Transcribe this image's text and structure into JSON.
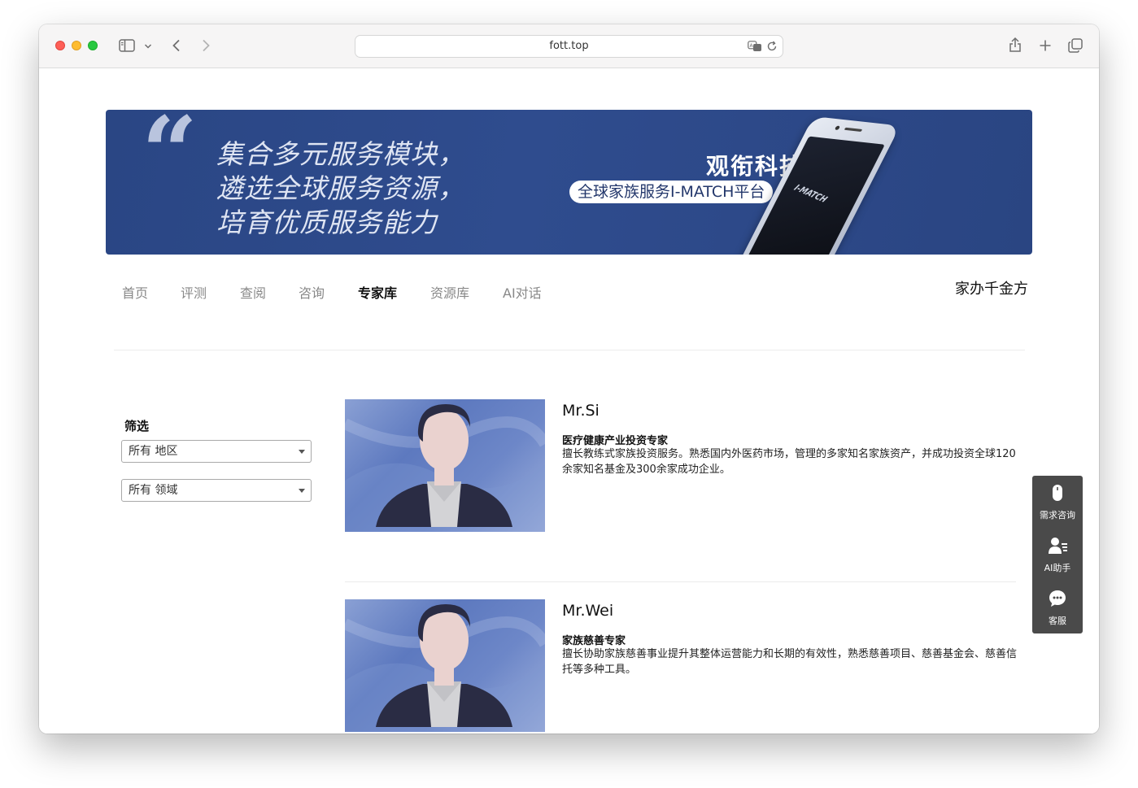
{
  "browser": {
    "url": "fott.top"
  },
  "banner": {
    "slogan_lines": [
      "集合多元服务模块，",
      "遴选全球服务资源，",
      "培育优质服务能力"
    ],
    "brand": "观衔科技",
    "platform": "全球家族服务I-MATCH平台",
    "phone_label": "I-MATCH"
  },
  "nav": {
    "items": [
      {
        "label": "首页",
        "active": false
      },
      {
        "label": "评测",
        "active": false
      },
      {
        "label": "查阅",
        "active": false
      },
      {
        "label": "咨询",
        "active": false
      },
      {
        "label": "专家库",
        "active": true
      },
      {
        "label": "资源库",
        "active": false
      },
      {
        "label": "AI对话",
        "active": false
      }
    ],
    "brand": "家办千金方"
  },
  "filter": {
    "title": "筛选",
    "region_select": "所有 地区",
    "field_select": "所有 领域"
  },
  "experts": [
    {
      "name": "Mr.Si",
      "role": "医疗健康产业投资专家",
      "description": "擅长教练式家族投资服务。熟悉国内外医药市场，管理的多家知名家族资产，并成功投资全球120余家知名基金及300余家成功企业。"
    },
    {
      "name": "Mr.Wei",
      "role": "家族慈善专家",
      "description": "擅长协助家族慈善事业提升其整体运营能力和长期的有效性，熟悉慈善项目、慈善基金会、慈善信托等多种工具。"
    }
  ],
  "side_panel": {
    "items": [
      {
        "label": "需求咨询",
        "icon": "mouse-icon"
      },
      {
        "label": "AI助手",
        "icon": "user-list-icon"
      },
      {
        "label": "客服",
        "icon": "chat-bubble-icon"
      }
    ]
  },
  "colors": {
    "banner_bg": "#2f4c8e",
    "side_panel_bg": "#4a4a4a",
    "nav_active": "#111111",
    "nav_inactive": "#888888"
  }
}
